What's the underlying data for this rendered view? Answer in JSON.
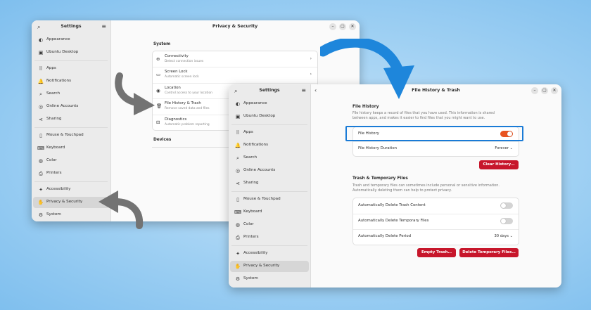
{
  "back_window": {
    "sidebar_title": "Settings",
    "title": "Privacy & Security",
    "nav": [
      {
        "label": "Appearance",
        "icon": "appearance-icon",
        "glyph": "◐"
      },
      {
        "label": "Ubuntu Desktop",
        "icon": "desktop-icon",
        "glyph": "▣"
      },
      {
        "label": "Apps",
        "icon": "apps-icon",
        "glyph": "⠿"
      },
      {
        "label": "Notifications",
        "icon": "bell-icon",
        "glyph": "🔔"
      },
      {
        "label": "Search",
        "icon": "search-icon",
        "glyph": "⌕"
      },
      {
        "label": "Online Accounts",
        "icon": "online-accounts-icon",
        "glyph": "◎"
      },
      {
        "label": "Sharing",
        "icon": "share-icon",
        "glyph": "⋖"
      },
      {
        "label": "Mouse & Touchpad",
        "icon": "mouse-icon",
        "glyph": "▯"
      },
      {
        "label": "Keyboard",
        "icon": "keyboard-icon",
        "glyph": "⌨"
      },
      {
        "label": "Color",
        "icon": "color-icon",
        "glyph": "◍"
      },
      {
        "label": "Printers",
        "icon": "printer-icon",
        "glyph": "⎙"
      },
      {
        "label": "Accessibility",
        "icon": "accessibility-icon",
        "glyph": "✦"
      },
      {
        "label": "Privacy & Security",
        "icon": "hand-icon",
        "glyph": "✋"
      },
      {
        "label": "System",
        "icon": "system-icon",
        "glyph": "⚙"
      }
    ],
    "section_system": "System",
    "rows": [
      {
        "label": "Connectivity",
        "sub": "Detect connection issues",
        "icon": "connectivity-icon",
        "glyph": "⊕"
      },
      {
        "label": "Screen Lock",
        "sub": "Automatic screen lock",
        "icon": "screen-lock-icon",
        "glyph": "▭"
      },
      {
        "label": "Location",
        "sub": "Control access to your location",
        "icon": "location-icon",
        "glyph": "◉"
      },
      {
        "label": "File History & Trash",
        "sub": "Remove saved data and files",
        "icon": "trash-icon",
        "glyph": "🗑"
      },
      {
        "label": "Diagnostics",
        "sub": "Automatic problem reporting",
        "icon": "diagnostics-icon",
        "glyph": "⊟"
      }
    ],
    "section_devices": "Devices"
  },
  "front_window": {
    "sidebar_title": "Settings",
    "title": "File History & Trash",
    "file_history": {
      "heading": "File History",
      "description_1": "File history keeps a record of files that you have used. This information is shared",
      "description_2": "between apps, and makes it easier to find files that you might want to use.",
      "toggle_label": "File History",
      "toggle_on": true,
      "duration_label": "File History Duration",
      "duration_value": "Forever",
      "clear_button": "Clear History…"
    },
    "trash": {
      "heading": "Trash & Temporary Files",
      "description_1": "Trash and temporary files can sometimes include personal or sensitive information.",
      "description_2": "Automatically deleting them can help to protect privacy.",
      "auto_trash_label": "Automatically Delete Trash Content",
      "auto_trash_on": false,
      "auto_temp_label": "Automatically Delete Temporary Files",
      "auto_temp_on": false,
      "period_label": "Automatically Delete Period",
      "period_value": "30 days",
      "empty_button": "Empty Trash…",
      "delete_button": "Delete Temporary Files…"
    }
  },
  "colors": {
    "accent": "#e95420",
    "destructive": "#c7162b",
    "highlight": "#1a7bd6",
    "arrow_blue": "#1e86db",
    "arrow_gray": "#737373"
  }
}
